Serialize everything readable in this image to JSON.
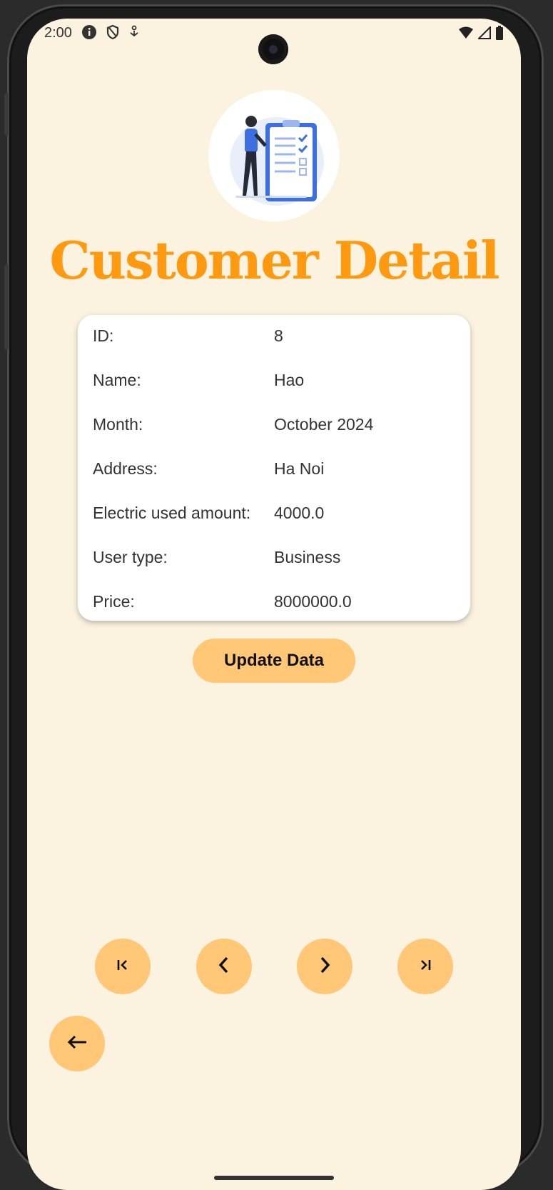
{
  "status_bar": {
    "time": "2:00",
    "left_icons": [
      "info-icon",
      "shield-icon",
      "download-icon"
    ],
    "right_icons": [
      "wifi-icon",
      "signal-icon",
      "battery-icon"
    ]
  },
  "header": {
    "illustration": "clipboard-checklist-illustration",
    "title": "Customer Detail"
  },
  "details": [
    {
      "label": "ID:",
      "value": "8"
    },
    {
      "label": "Name:",
      "value": "Hao"
    },
    {
      "label": "Month:",
      "value": "October 2024"
    },
    {
      "label": "Address:",
      "value": "Ha Noi"
    },
    {
      "label": "Electric used amount:",
      "value": "4000.0"
    },
    {
      "label": "User type:",
      "value": "Business"
    },
    {
      "label": "Price:",
      "value": "8000000.0"
    }
  ],
  "actions": {
    "update_label": "Update Data"
  },
  "navigation": {
    "first_icon": "first-page-icon",
    "prev_icon": "chevron-left-icon",
    "next_icon": "chevron-right-icon",
    "last_icon": "last-page-icon",
    "back_icon": "arrow-left-icon"
  },
  "colors": {
    "background": "#fbf2df",
    "accent": "#ff9a10",
    "button": "#ffc776",
    "card": "#ffffff"
  }
}
